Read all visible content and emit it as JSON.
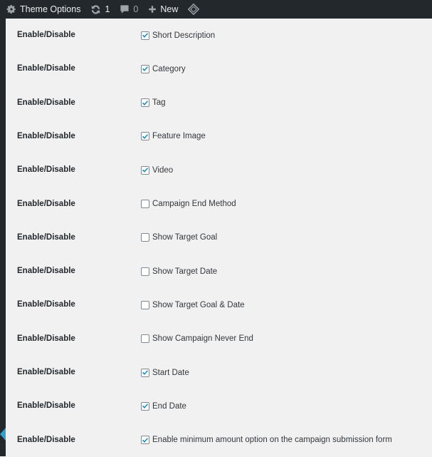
{
  "adminbar": {
    "site_title": "Theme Options",
    "updates_count": "1",
    "comments_count": "0",
    "new_label": "New",
    "accent": "#2ea2cc"
  },
  "settings": {
    "rows": [
      {
        "label": "Enable/Disable",
        "option": "Short Description",
        "checked": true
      },
      {
        "label": "Enable/Disable",
        "option": "Category",
        "checked": true
      },
      {
        "label": "Enable/Disable",
        "option": "Tag",
        "checked": true
      },
      {
        "label": "Enable/Disable",
        "option": "Feature Image",
        "checked": true
      },
      {
        "label": "Enable/Disable",
        "option": "Video",
        "checked": true
      },
      {
        "label": "Enable/Disable",
        "option": "Campaign End Method",
        "checked": false
      },
      {
        "label": "Enable/Disable",
        "option": "Show Target Goal",
        "checked": false
      },
      {
        "label": "Enable/Disable",
        "option": "Show Target Date",
        "checked": false
      },
      {
        "label": "Enable/Disable",
        "option": "Show Target Goal & Date",
        "checked": false
      },
      {
        "label": "Enable/Disable",
        "option": "Show Campaign Never End",
        "checked": false
      },
      {
        "label": "Enable/Disable",
        "option": "Start Date",
        "checked": true
      },
      {
        "label": "Enable/Disable",
        "option": "End Date",
        "checked": true
      },
      {
        "label": "Enable/Disable",
        "option": "Enable minimum amount option on the campaign submission form",
        "checked": true
      }
    ]
  }
}
